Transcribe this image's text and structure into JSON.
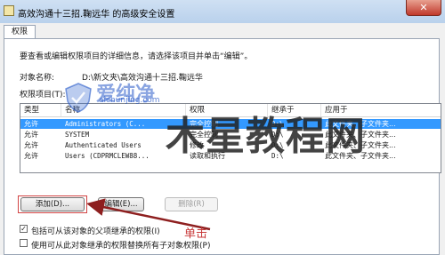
{
  "window": {
    "title": "高效沟通十三招.鞠远华 的高级安全设置",
    "close_glyph": "✕"
  },
  "tab": {
    "label": "权限"
  },
  "intro_text": "要查看或编辑权限项目的详细信息，请选择该项目并单击“编辑”。",
  "object_name": {
    "label": "对象名称:",
    "value": "D:\\新文夹\\高效沟通十三招.鞠远华"
  },
  "permission_entries_label": "权限项目(T):",
  "table": {
    "columns": [
      "类型",
      "名称",
      "权限",
      "继承于",
      "应用于"
    ],
    "rows": [
      {
        "type": "允许",
        "name": "Administrators (C...",
        "permission": "完全控制",
        "inherited": "D:\\",
        "applies": "此文件夹、子文件夹...",
        "selected": true
      },
      {
        "type": "允许",
        "name": "SYSTEM",
        "permission": "完全控制",
        "inherited": "D:\\",
        "applies": "此文件夹、子文件夹...",
        "selected": false
      },
      {
        "type": "允许",
        "name": "Authenticated Users",
        "permission": "修改",
        "inherited": "D:\\",
        "applies": "此文件夹、子文件夹...",
        "selected": false
      },
      {
        "type": "允许",
        "name": "Users (CDPRMCLEW88...",
        "permission": "读取和执行",
        "inherited": "D:\\",
        "applies": "此文件夹、子文件夹...",
        "selected": false
      }
    ]
  },
  "buttons": {
    "add": "添加(D)...",
    "edit": "编辑(E)...",
    "delete": "删除(R)"
  },
  "checkboxes": [
    {
      "label": "包括可从该对象的父项继承的权限(I)",
      "checked": true
    },
    {
      "label": "使用可从此对象继承的权限替换所有子对象权限(P)",
      "checked": false
    }
  ],
  "watermark": {
    "text_large": "木星教程网",
    "text_small": "爱纯净",
    "url": "aichunjing.com"
  },
  "annotation": {
    "text": "单击",
    "color": "#c83a3a"
  },
  "colors": {
    "selection": "#3399ff",
    "highlight_box": "#d24444"
  }
}
